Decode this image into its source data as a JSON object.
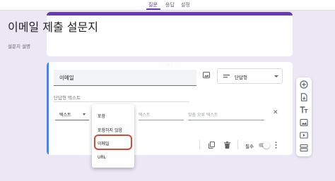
{
  "tabs": [
    {
      "label": "질문",
      "active": true
    },
    {
      "label": "응답",
      "active": false
    },
    {
      "label": "설정",
      "active": false
    }
  ],
  "form": {
    "title": "이메일 제출 설문지",
    "description": "설문지 설명"
  },
  "question": {
    "title": "이메일",
    "type": "단답형",
    "answer_placeholder": "단답형 텍스트",
    "validation": {
      "category": "텍스트",
      "text_placeholder": "텍스트",
      "error_placeholder": "맞춤 오류 텍스트"
    },
    "required_label": "필수",
    "required": false
  },
  "validation_menu": {
    "items": [
      "포함",
      "포함하지 않음",
      "이메일",
      "URL"
    ],
    "highlighted": "이메일"
  },
  "colors": {
    "accent": "#673ab7",
    "active_card": "#4285f4",
    "background": "#ece7f4",
    "highlight_outline": "#d24a34"
  },
  "icons": {
    "question_image": "image-icon",
    "type": "short-text-icon",
    "close": "close-icon",
    "copy": "copy-icon",
    "delete": "trash-icon",
    "more": "more-vert-icon",
    "toolbar": [
      "add-circle-icon",
      "import-icon",
      "title-icon",
      "image-icon",
      "video-icon",
      "section-icon"
    ]
  }
}
